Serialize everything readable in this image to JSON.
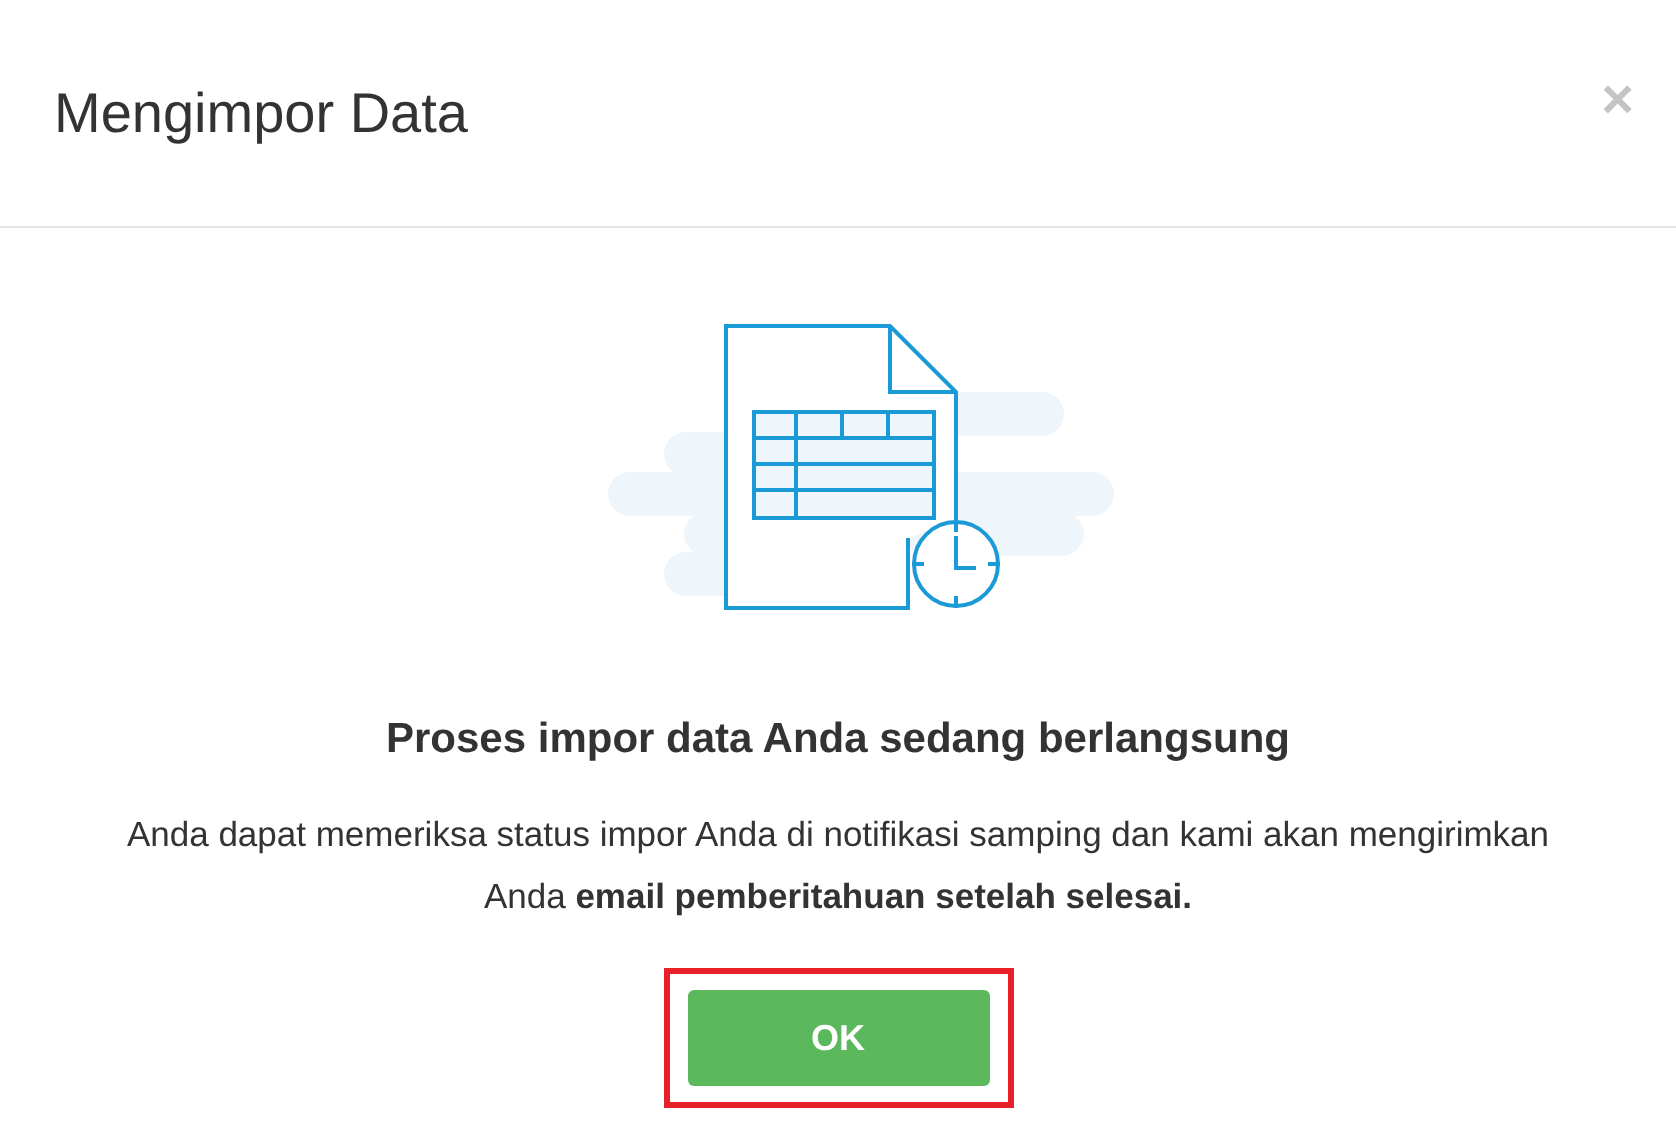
{
  "dialog": {
    "title": "Mengimpor Data",
    "close": "×",
    "heading": "Proses impor data Anda sedang berlangsung",
    "message": "Anda dapat memeriksa status impor Anda di notifikasi samping dan kami akan mengirimkan Anda **email pemberitahuan setelah selesai.**",
    "button": "OK",
    "button_highlighted": true
  }
}
